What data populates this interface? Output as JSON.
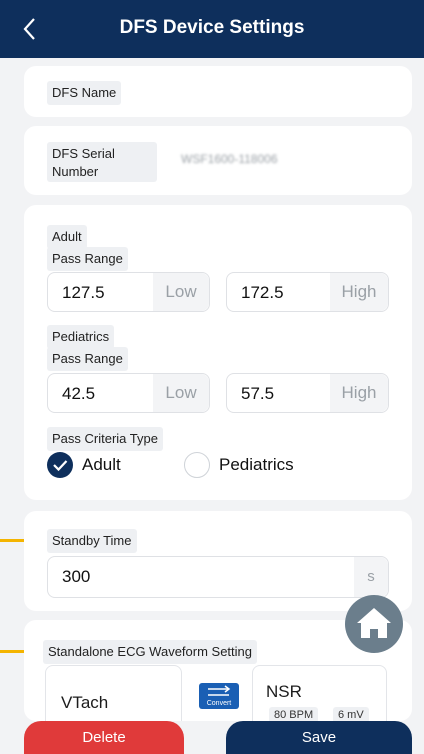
{
  "header": {
    "title": "DFS Device Settings",
    "back_icon": "chevron-left-icon"
  },
  "dfs_name": {
    "label": "DFS Name"
  },
  "dfs_serial": {
    "label_line1": "DFS Serial",
    "label_line2": "Number",
    "value": "WSF1600-118006"
  },
  "pass_range": {
    "adult_label": "Adult",
    "adult_range_label": "Pass Range",
    "adult_low": "127.5",
    "adult_low_unit": "Low",
    "adult_high": "172.5",
    "adult_high_unit": "High",
    "pediatrics_label": "Pediatrics",
    "pediatrics_range_label": "Pass Range",
    "pediatrics_low": "42.5",
    "pediatrics_low_unit": "Low",
    "pediatrics_high": "57.5",
    "pediatrics_high_unit": "High",
    "criteria_label": "Pass Criteria Type",
    "option_adult": "Adult",
    "option_pediatrics": "Pediatrics",
    "selected": "Adult"
  },
  "standby": {
    "label": "Standby Time",
    "value": "300",
    "unit": "s"
  },
  "ecg": {
    "label": "Standalone ECG Waveform Setting",
    "left_wave": "VTach",
    "convert_label": "Convert",
    "right_wave": "NSR",
    "bpm": "80 BPM",
    "mv": "6 mV"
  },
  "actions": {
    "delete": "Delete",
    "save": "Save"
  },
  "colors": {
    "primary": "#0e2f5c",
    "danger": "#e03a3a",
    "marker": "#f4b400",
    "fab": "#6b7e8c"
  }
}
